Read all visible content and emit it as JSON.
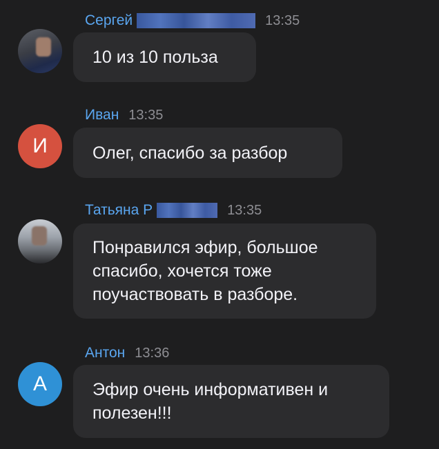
{
  "messages": [
    {
      "sender": "Сергей",
      "time": "13:35",
      "avatar_initial": "",
      "text": "10 из 10 польза"
    },
    {
      "sender": "Иван",
      "time": "13:35",
      "avatar_initial": "И",
      "text": "Олег, спасибо за разбор"
    },
    {
      "sender": "Татьяна Р",
      "time": "13:35",
      "avatar_initial": "",
      "text": "Понравился эфир, большое\nспасибо, хочется тоже\nпоучаствовать в разборе."
    },
    {
      "sender": "Антон",
      "time": "13:36",
      "avatar_initial": "А",
      "text": "Эфир очень информативен и\nполезен!!!"
    }
  ],
  "colors": {
    "background": "#1e1e1f",
    "bubble": "#2c2c2e",
    "sender_name": "#5aa6f0",
    "timestamp": "#8e8e93",
    "message_text": "#f2f2f7",
    "avatar_red": "#d5513f",
    "avatar_blue": "#2f91d6"
  }
}
